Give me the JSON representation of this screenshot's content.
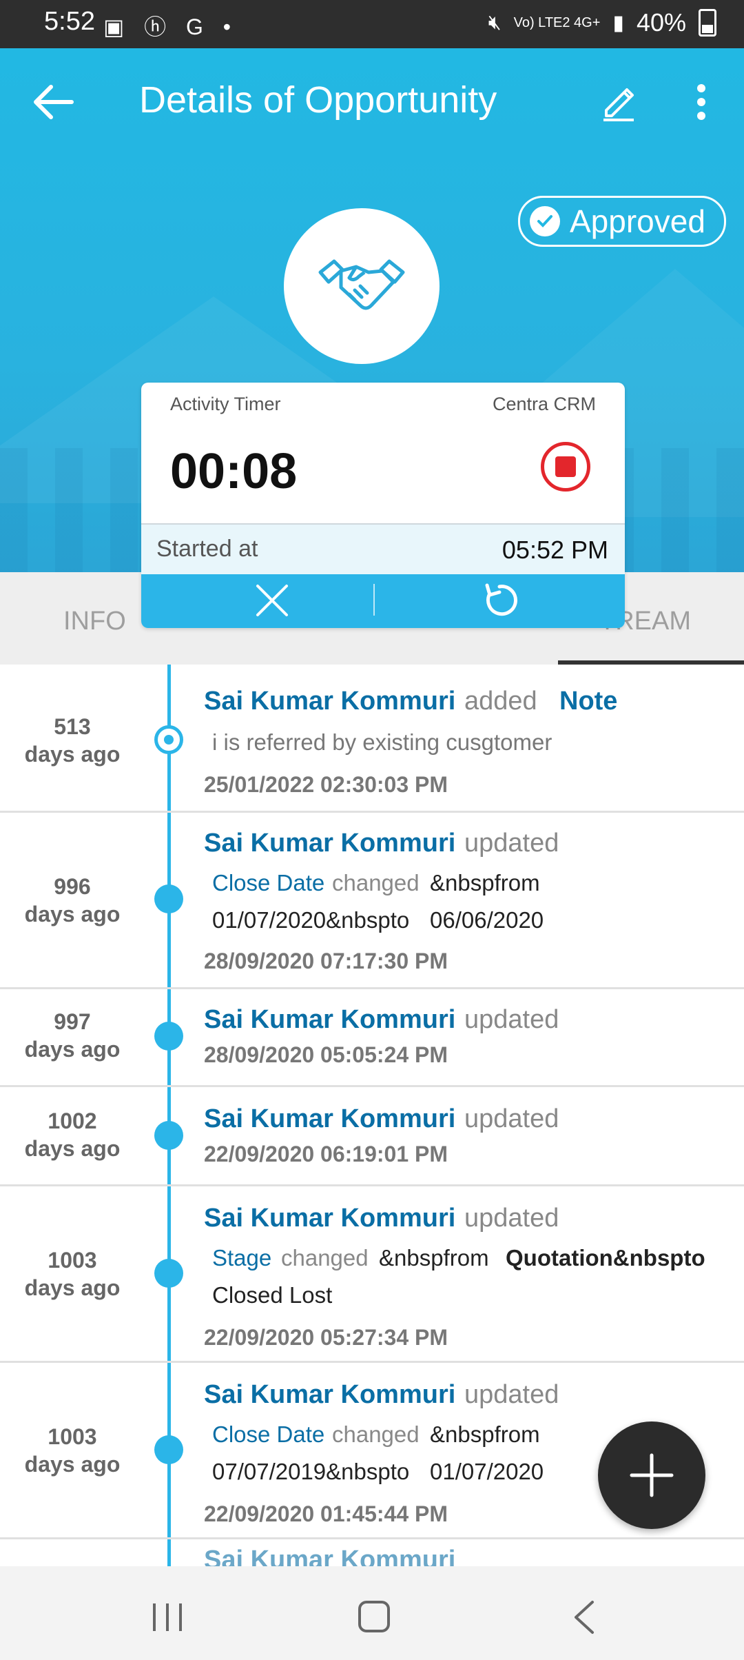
{
  "status_bar": {
    "time": "5:52",
    "left_icons": "▣ ⓗ G •",
    "network": "Vo) LTE2 4G+",
    "battery": "40%"
  },
  "header": {
    "title": "Details of Opportunity",
    "status_badge": "Approved"
  },
  "timer": {
    "label": "Activity Timer",
    "app_name": "Centra CRM",
    "elapsed": "00:08",
    "started_label": "Started at",
    "started_value": "05:52 PM"
  },
  "tabs": {
    "info": "INFO",
    "stream": "TREAM"
  },
  "timeline": [
    {
      "ago_num": "513",
      "ago_unit": "days ago",
      "user": "Sai Kumar Kommuri",
      "action": "added",
      "keyword": "Note",
      "note": "i is referred by existing cusgtomer",
      "timestamp": "25/01/2022 02:30:03 PM"
    },
    {
      "ago_num": "996",
      "ago_unit": "days ago",
      "user": "Sai Kumar Kommuri",
      "action": "updated",
      "field": "Close Date",
      "changed": "changed",
      "from_label": "&nbspfrom",
      "from_value": "01/07/2020&nbspto",
      "to_value": "06/06/2020",
      "timestamp": "28/09/2020 07:17:30 PM"
    },
    {
      "ago_num": "997",
      "ago_unit": "days ago",
      "user": "Sai Kumar Kommuri",
      "action": "updated",
      "timestamp": "28/09/2020 05:05:24 PM"
    },
    {
      "ago_num": "1002",
      "ago_unit": "days ago",
      "user": "Sai Kumar Kommuri",
      "action": "updated",
      "timestamp": "22/09/2020 06:19:01 PM"
    },
    {
      "ago_num": "1003",
      "ago_unit": "days ago",
      "user": "Sai Kumar Kommuri",
      "action": "updated",
      "field": "Stage",
      "changed": "changed",
      "from_label": "&nbspfrom",
      "from_value": "Quotation&nbspto",
      "to_value": "Closed Lost",
      "timestamp": "22/09/2020 05:27:34 PM"
    },
    {
      "ago_num": "1003",
      "ago_unit": "days ago",
      "user": "Sai Kumar Kommuri",
      "action": "updated",
      "field": "Close Date",
      "changed": "changed",
      "from_label": "&nbspfrom",
      "from_value": "07/07/2019&nbspto",
      "to_value": "01/07/2020",
      "timestamp": "22/09/2020 01:45:44 PM"
    }
  ],
  "colors": {
    "header_bg": "#22b8e3",
    "accent": "#2bb5e8",
    "link_blue": "#0a6ea5",
    "stop_red": "#e3262c",
    "fab_bg": "#2b2b2b"
  },
  "icons": {
    "back": "arrow-left-icon",
    "edit": "pencil-icon",
    "more": "more-vert-icon",
    "approved": "check-circle-icon",
    "logo": "handshake-icon",
    "stop": "stop-icon",
    "cancel": "close-icon",
    "reset": "refresh-icon",
    "fab": "plus-icon"
  }
}
